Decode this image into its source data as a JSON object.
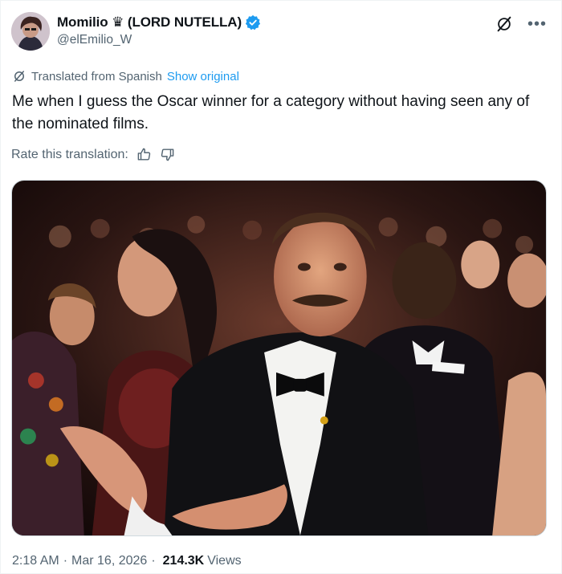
{
  "author": {
    "display_name": "Momilio ♛ (LORD NUTELLA)",
    "handle": "@elEmilio_W"
  },
  "translation": {
    "label": "Translated from Spanish",
    "show_original": "Show original"
  },
  "tweet": {
    "text": "Me when I guess the Oscar winner for a category without having seen any of the nominated films."
  },
  "rate": {
    "label": "Rate this translation:"
  },
  "meta": {
    "time": "2:18 AM",
    "sep1": "·",
    "date": "Mar 16, 2026",
    "sep2": "·",
    "views_count": "214.3K",
    "views_label": "Views"
  },
  "colors": {
    "accent": "#1d9bf0",
    "secondary_text": "#536471",
    "primary_text": "#0f1419"
  },
  "icons": [
    "verified-badge-icon",
    "grok-icon",
    "more-icon",
    "translate-icon",
    "thumbs-up-icon",
    "thumbs-down-icon"
  ]
}
